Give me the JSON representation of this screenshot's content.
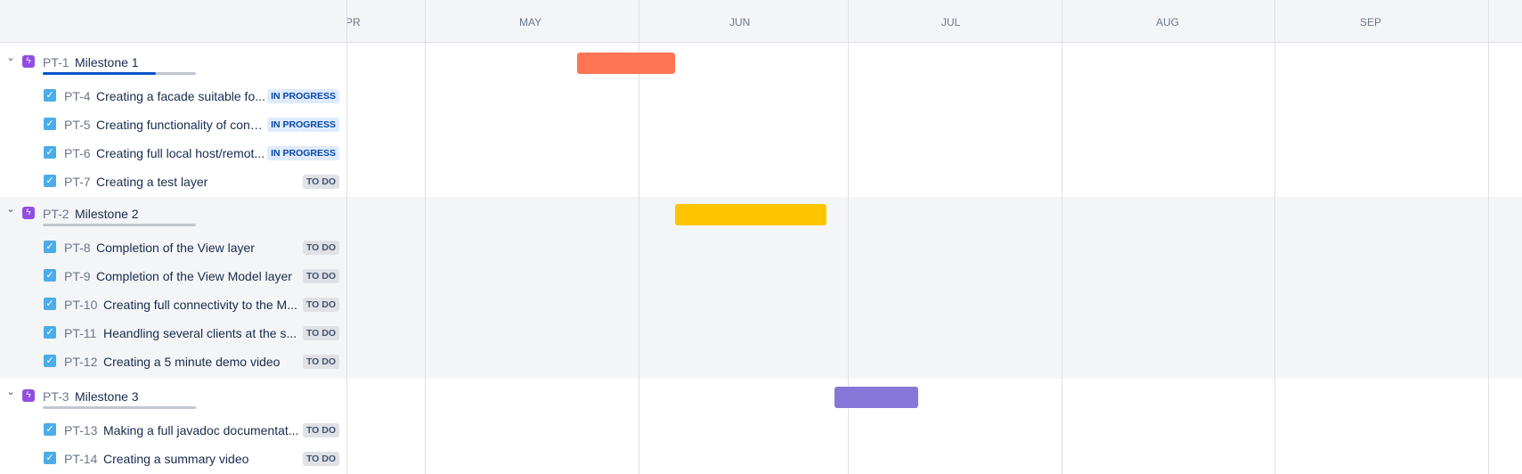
{
  "timeline": {
    "months": [
      "PR",
      "MAY",
      "JUN",
      "JUL",
      "AUG",
      "SEP"
    ]
  },
  "epics": [
    {
      "key": "PT-1",
      "title": "Milestone 1",
      "progress": 0.74,
      "bar_color": "#ff7452",
      "issues": [
        {
          "key": "PT-4",
          "title": "Creating a facade suitable fo...",
          "status": "IN PROGRESS"
        },
        {
          "key": "PT-5",
          "title": "Creating functionality of conn...",
          "status": "IN PROGRESS"
        },
        {
          "key": "PT-6",
          "title": "Creating full local host/remot...",
          "status": "IN PROGRESS"
        },
        {
          "key": "PT-7",
          "title": "Creating a test layer",
          "status": "TO DO"
        }
      ]
    },
    {
      "key": "PT-2",
      "title": "Milestone 2",
      "progress": 0,
      "bar_color": "#ffc400",
      "issues": [
        {
          "key": "PT-8",
          "title": "Completion of the View layer",
          "status": "TO DO"
        },
        {
          "key": "PT-9",
          "title": "Completion of the View Model layer",
          "status": "TO DO"
        },
        {
          "key": "PT-10",
          "title": "Creating full connectivity to the M...",
          "status": "TO DO"
        },
        {
          "key": "PT-11",
          "title": "Heandling several clients at the s...",
          "status": "TO DO"
        },
        {
          "key": "PT-12",
          "title": "Creating a 5 minute demo video",
          "status": "TO DO"
        }
      ]
    },
    {
      "key": "PT-3",
      "title": "Milestone 3",
      "progress": 0,
      "bar_color": "#8777d9",
      "issues": [
        {
          "key": "PT-13",
          "title": "Making a full javadoc documentat...",
          "status": "TO DO"
        },
        {
          "key": "PT-14",
          "title": "Creating a summary video",
          "status": "TO DO"
        }
      ]
    }
  ]
}
